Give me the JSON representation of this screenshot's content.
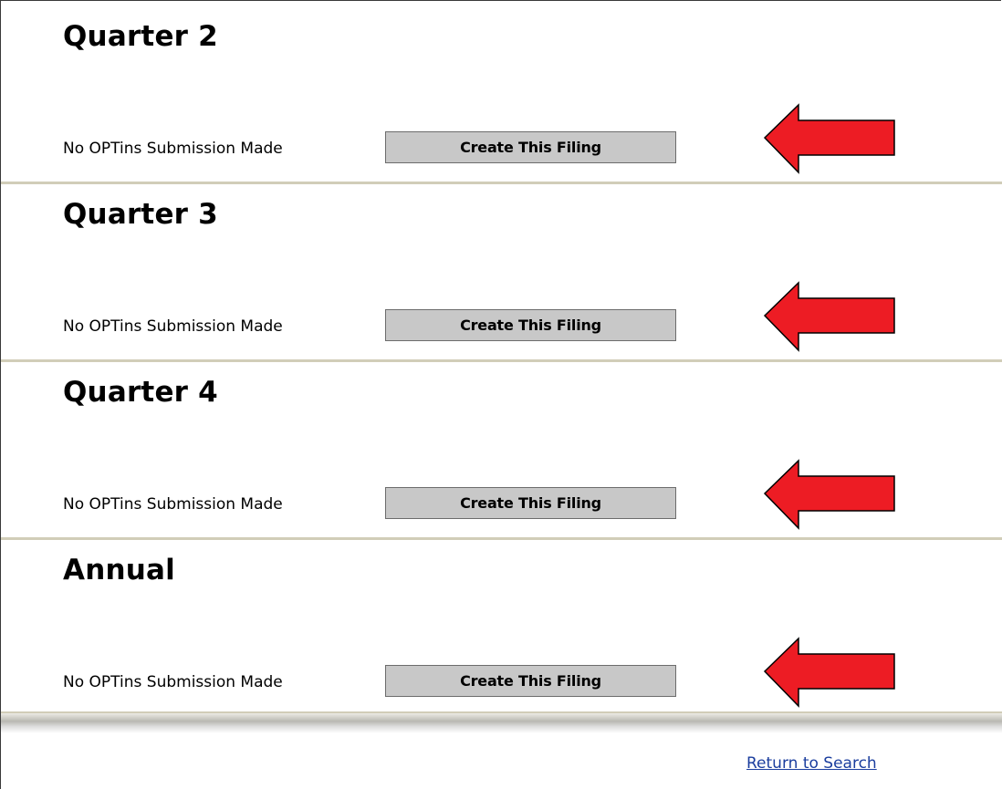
{
  "sections": [
    {
      "title": "Quarter 2",
      "status": "No OPTins Submission Made",
      "button_label": "Create This Filing"
    },
    {
      "title": "Quarter 3",
      "status": "No OPTins Submission Made",
      "button_label": "Create This Filing"
    },
    {
      "title": "Quarter 4",
      "status": "No OPTins Submission Made",
      "button_label": "Create This Filing"
    },
    {
      "title": "Annual",
      "status": "No OPTins Submission Made",
      "button_label": "Create This Filing"
    }
  ],
  "annotation": {
    "icon": "left-arrow-icon",
    "color": "#ed1c24",
    "outline": "#000000"
  },
  "colors": {
    "button_bg": "#c8c8c8",
    "divider": "#d1cdb8",
    "link": "#1a3d9e"
  },
  "footer": {
    "return_link": "Return to Search"
  }
}
